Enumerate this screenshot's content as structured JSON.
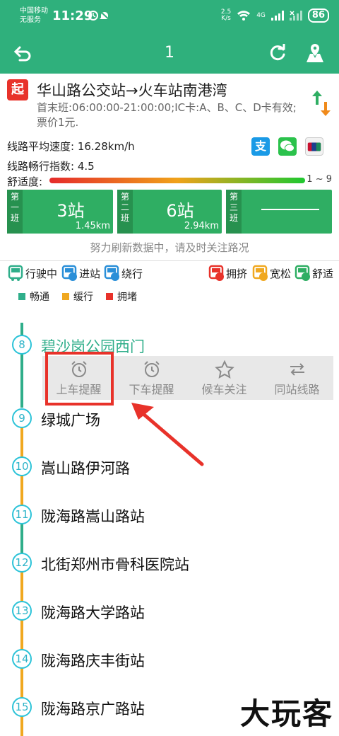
{
  "status_bar": {
    "carrier": "中国移动",
    "service": "无服务",
    "time": "11:29",
    "net_speed_value": "2.5",
    "net_speed_unit": "K/s",
    "signal": "4G",
    "battery": "86"
  },
  "header": {
    "title": "1"
  },
  "route": {
    "start_badge": "起",
    "name": "华山路公交站→火车站南港湾",
    "detail": "首末班:06:00:00-21:00:00;IC卡:A、B、C、D卡有效;票价1元."
  },
  "stats": {
    "avg_speed": "线路平均速度: 16.28km/h",
    "smoothness": "线路畅行指数: 4.5",
    "comfort_label": "舒适度:",
    "comfort_range": "1 ~ 9"
  },
  "payments": {
    "alipay_glyph": "支"
  },
  "buses": [
    {
      "label": [
        "第",
        "一",
        "班"
      ],
      "stations": "3站",
      "distance": "1.45km"
    },
    {
      "label": [
        "第",
        "二",
        "班"
      ],
      "stations": "6站",
      "distance": "2.94km"
    },
    {
      "label": [
        "第",
        "三",
        "班"
      ],
      "stations": "",
      "distance": ""
    }
  ],
  "notice": "努力刷新数据中，请及时关注路况",
  "legend_bus": [
    {
      "label": "行驶中",
      "color": "#2fae8a"
    },
    {
      "label": "进站",
      "color": "#2a8fd8"
    },
    {
      "label": "绕行",
      "color": "#2a8fd8"
    },
    {
      "label": "拥挤",
      "color": "#e8322a"
    },
    {
      "label": "宽松",
      "color": "#f0a820"
    },
    {
      "label": "舒适",
      "color": "#2fae63"
    }
  ],
  "legend_road": [
    {
      "label": "畅通",
      "color": "#2fae8a"
    },
    {
      "label": "缓行",
      "color": "#f0a820"
    },
    {
      "label": "拥堵",
      "color": "#e8322a"
    }
  ],
  "actions": [
    {
      "label": "上车提醒"
    },
    {
      "label": "下车提醒"
    },
    {
      "label": "候车关注"
    },
    {
      "label": "同站线路"
    }
  ],
  "stops": [
    {
      "number": "8",
      "name": "碧沙岗公园西门"
    },
    {
      "number": "9",
      "name": "绿城广场"
    },
    {
      "number": "10",
      "name": "嵩山路伊河路"
    },
    {
      "number": "11",
      "name": "陇海路嵩山路站"
    },
    {
      "number": "12",
      "name": "北街郑州市骨科医院站"
    },
    {
      "number": "13",
      "name": "陇海路大学路站"
    },
    {
      "number": "14",
      "name": "陇海路庆丰街站"
    },
    {
      "number": "15",
      "name": "陇海路京广路站"
    }
  ],
  "watermark": "大玩客"
}
